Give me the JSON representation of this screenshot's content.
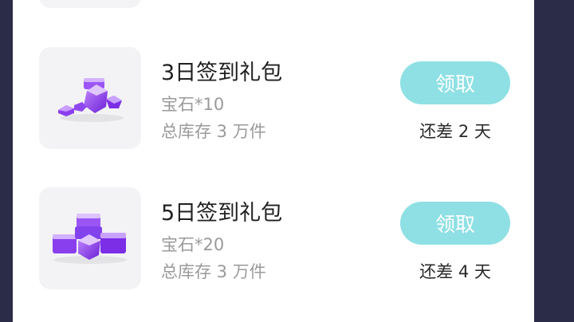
{
  "packages": [
    {
      "title": "3日签到礼包",
      "reward": "宝石*10",
      "stock": "总库存 3 万件",
      "button_label": "领取",
      "remaining": "还差 2 天",
      "icon": "gem-small-icon"
    },
    {
      "title": "5日签到礼包",
      "reward": "宝石*20",
      "stock": "总库存 3 万件",
      "button_label": "领取",
      "remaining": "还差 4 天",
      "icon": "gem-large-icon"
    }
  ],
  "colors": {
    "frame": "#2b2c47",
    "card": "#ffffff",
    "button": "#8fe0e4",
    "muted_text": "#9a9a9a"
  }
}
